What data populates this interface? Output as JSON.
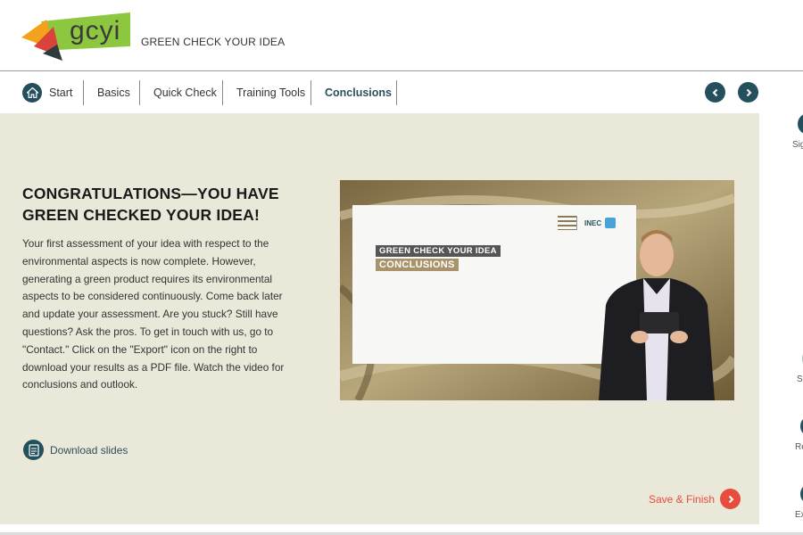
{
  "header": {
    "logo_text": "gcyi",
    "app_title": "GREEN CHECK YOUR IDEA"
  },
  "nav": {
    "items": [
      {
        "label": "Start",
        "icon": "home-icon"
      },
      {
        "label": "Basics"
      },
      {
        "label": "Quick Check"
      },
      {
        "label": "Training Tools"
      },
      {
        "label": "Conclusions",
        "active": true
      }
    ],
    "prev_icon": "chevron-left-icon",
    "next_icon": "chevron-right-icon"
  },
  "main": {
    "heading": "CONGRATULATIONS—YOU HAVE GREEN CHECKED YOUR IDEA!",
    "body": "Your first assessment of your idea with respect to the environmental aspects is now complete. However, generating a green product requires its environmental aspects to be considered continuously. Come back later and update your assessment. Are you stuck? Still have questions? Ask the pros. To get in touch with us, go to \"Contact.\" Click on the \"Export\" icon on the right to download your results as a PDF file. Watch the video for conclusions and outlook.",
    "video": {
      "slide_title": "GREEN CHECK YOUR IDEA",
      "slide_subtitle": "CONCLUSIONS",
      "logo_right": "INEC"
    },
    "download_label": "Download slides",
    "save_label": "Save & Finish"
  },
  "sidebar": {
    "items": [
      {
        "label": "Sig",
        "icon": "sign-icon"
      },
      {
        "label": "S",
        "icon": "save-icon"
      },
      {
        "label": "Re",
        "icon": "reset-icon"
      },
      {
        "label": "Ex",
        "icon": "export-icon"
      }
    ]
  },
  "colors": {
    "accent": "#24505e",
    "content_bg": "#eae8d9",
    "save_red": "#e74c3c",
    "logo_green": "#8dc63f",
    "logo_red": "#d9433a",
    "logo_orange": "#f3a21d"
  }
}
